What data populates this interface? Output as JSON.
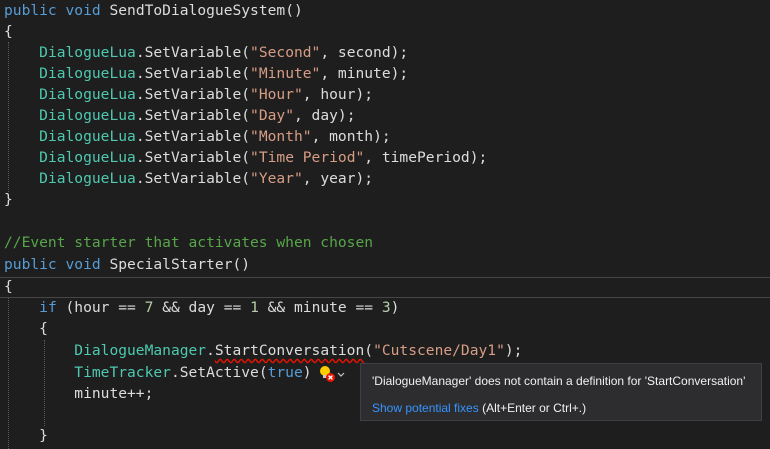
{
  "code": {
    "m1_public": "public",
    "m1_void": "void",
    "m1_name": "SendToDialogueSystem()",
    "brace_open": "{",
    "brace_close": "}",
    "lua_class": "DialogueLua",
    "set_var": ".SetVariable(",
    "vars": [
      {
        "key": "\"Second\"",
        "arg": ", second);"
      },
      {
        "key": "\"Minute\"",
        "arg": ", minute);"
      },
      {
        "key": "\"Hour\"",
        "arg": ", hour);"
      },
      {
        "key": "\"Day\"",
        "arg": ", day);"
      },
      {
        "key": "\"Month\"",
        "arg": ", month);"
      },
      {
        "key": "\"Time Period\"",
        "arg": ", timePeriod);"
      },
      {
        "key": "\"Year\"",
        "arg": ", year);"
      }
    ],
    "comment": "//Event starter that activates when chosen",
    "m2_public": "public",
    "m2_void": "void",
    "m2_name": "SpecialStarter()",
    "if_kw": "if",
    "if_p1": " (hour == ",
    "if_n1": "7",
    "if_p2": " && day == ",
    "if_n2": "1",
    "if_p3": " && minute == ",
    "if_n3": "3",
    "if_p4": ")",
    "dm_class": "DialogueManager",
    "dot": ".",
    "start_conv": "StartConversation",
    "conv_open": "(",
    "conv_str": "\"Cutscene/Day1\"",
    "conv_close": ");",
    "tt_class": "TimeTracker",
    "set_active": ".SetActive(",
    "true_kw": "true",
    "set_active_close": ")",
    "minute_inc": "minute++;"
  },
  "tooltip": {
    "message": "'DialogueManager' does not contain a definition for 'StartConversation'",
    "link": "Show potential fixes",
    "shortcut": " (Alt+Enter or Ctrl+.)"
  },
  "colors": {
    "background": "#1e1e1e",
    "keyword": "#569cd6",
    "type": "#4ec9b0",
    "string": "#d69d85",
    "number": "#b5cea8",
    "comment": "#57a64a",
    "error": "#e51400",
    "link": "#3794ff"
  },
  "icons": {
    "lightbulb": "lightbulb-error-icon",
    "dropdown": "chevron-down-icon"
  }
}
